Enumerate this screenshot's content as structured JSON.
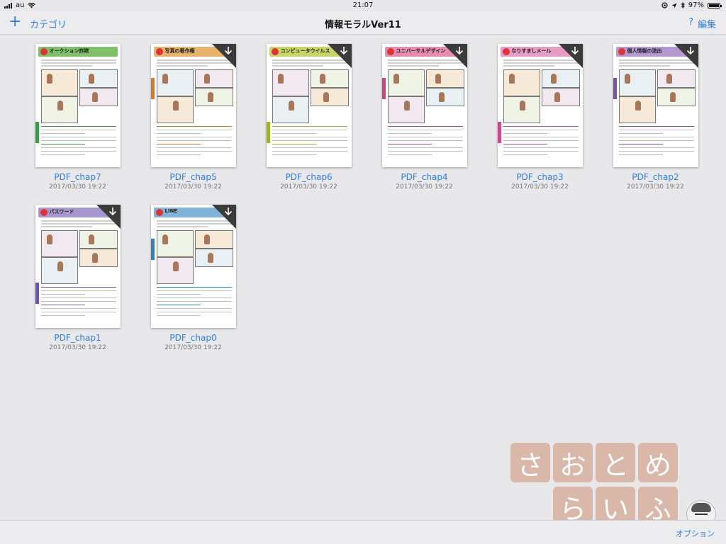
{
  "status_bar": {
    "carrier": "au",
    "time": "21:07",
    "battery": "97%",
    "battery_level": 0.97
  },
  "nav": {
    "add_icon": "+",
    "category_label": "カテゴリ",
    "title": "情報モラルVer11",
    "help_label": "?",
    "edit_label": "編集"
  },
  "documents": [
    {
      "name": "PDF_chap7",
      "date": "2017/03/30 19:22",
      "header": "オークション詐欺",
      "header_color": "#7fbf6a",
      "tab_color": "#3b9b4b",
      "downloaded": true
    },
    {
      "name": "PDF_chap5",
      "date": "2017/03/30 19:22",
      "header": "写真の著作権",
      "header_color": "#e7b36c",
      "tab_color": "#d07a2f",
      "downloaded": false
    },
    {
      "name": "PDF_chap6",
      "date": "2017/03/30 19:22",
      "header": "コンピュータウイルス",
      "header_color": "#c8d36a",
      "tab_color": "#9ab231",
      "downloaded": false
    },
    {
      "name": "PDF_chap4",
      "date": "2017/03/30 19:22",
      "header": "ユニバーサルデザイン",
      "header_color": "#e58cb0",
      "tab_color": "#d0427c",
      "downloaded": false
    },
    {
      "name": "PDF_chap3",
      "date": "2017/03/30 19:22",
      "header": "なりすましメール",
      "header_color": "#e59cc5",
      "tab_color": "#c64c8e",
      "downloaded": false
    },
    {
      "name": "PDF_chap2",
      "date": "2017/03/30 19:22",
      "header": "個人情報の流出",
      "header_color": "#b598cf",
      "tab_color": "#7e4ea8",
      "downloaded": false
    },
    {
      "name": "PDF_chap1",
      "date": "2017/03/30 19:22",
      "header": "パスワード",
      "header_color": "#a896cf",
      "tab_color": "#6c56a8",
      "downloaded": false
    },
    {
      "name": "PDF_chap0",
      "date": "2017/03/30 19:22",
      "header": "LINE",
      "header_color": "#7fb3d8",
      "tab_color": "#2f83b5",
      "downloaded": false
    }
  ],
  "watermark": {
    "row1": [
      "さ",
      "お",
      "と",
      "め"
    ],
    "row2": [
      "ら",
      "い",
      "ふ"
    ]
  },
  "toolbar": {
    "options_label": "オプション"
  }
}
